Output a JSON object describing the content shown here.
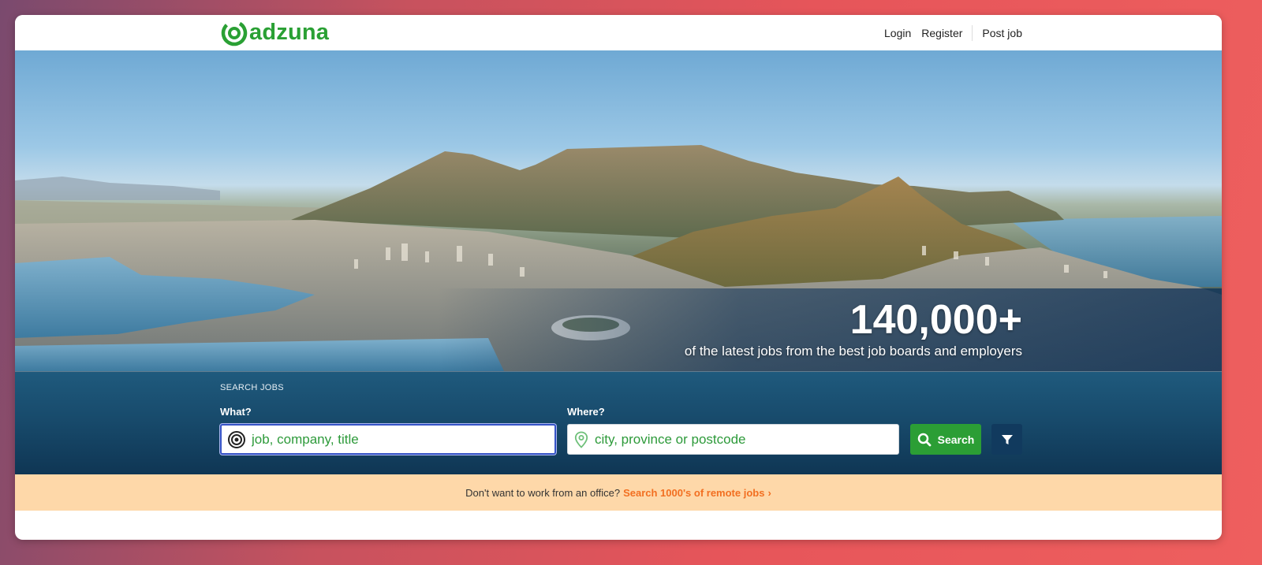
{
  "header": {
    "logo_text": "adzuna",
    "nav": {
      "login": "Login",
      "register": "Register",
      "post_job": "Post job"
    }
  },
  "hero": {
    "stat_number": "140,000+",
    "stat_text": "of the latest jobs from the best job boards and employers"
  },
  "search": {
    "heading": "SEARCH JOBS",
    "what_label": "What?",
    "what_placeholder": "job, company, title",
    "where_label": "Where?",
    "where_placeholder": "city, province or postcode",
    "search_button": "Search"
  },
  "remote_banner": {
    "text": "Don't want to work from an office?",
    "link": "Search 1000's of remote jobs"
  },
  "colors": {
    "brand_green": "#2aa034",
    "button_green": "#2b9e35",
    "filter_navy": "#113a5e",
    "banner_bg": "#fed8a9",
    "link_orange": "#f26f21"
  }
}
